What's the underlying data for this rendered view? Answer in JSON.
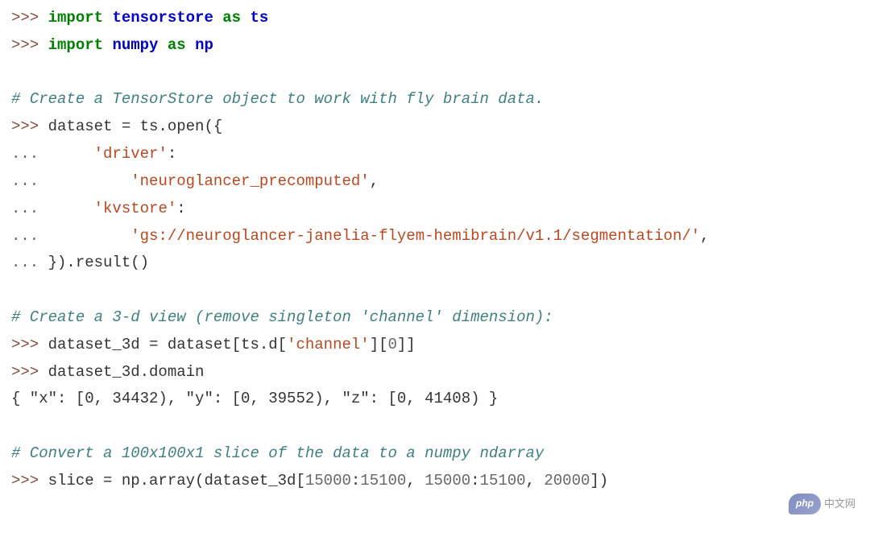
{
  "lines": [
    {
      "segments": [
        {
          "class": "prompt",
          "text": ">>> "
        },
        {
          "class": "keyword",
          "text": "import"
        },
        {
          "class": "normal",
          "text": " "
        },
        {
          "class": "module",
          "text": "tensorstore"
        },
        {
          "class": "normal",
          "text": " "
        },
        {
          "class": "keyword",
          "text": "as"
        },
        {
          "class": "normal",
          "text": " "
        },
        {
          "class": "module",
          "text": "ts"
        }
      ]
    },
    {
      "segments": [
        {
          "class": "prompt",
          "text": ">>> "
        },
        {
          "class": "keyword",
          "text": "import"
        },
        {
          "class": "normal",
          "text": " "
        },
        {
          "class": "module",
          "text": "numpy"
        },
        {
          "class": "normal",
          "text": " "
        },
        {
          "class": "keyword",
          "text": "as"
        },
        {
          "class": "normal",
          "text": " "
        },
        {
          "class": "module",
          "text": "np"
        }
      ]
    },
    {
      "segments": [
        {
          "class": "normal",
          "text": " "
        }
      ]
    },
    {
      "segments": [
        {
          "class": "comment",
          "text": "# Create a TensorStore object to work with fly brain data."
        }
      ]
    },
    {
      "segments": [
        {
          "class": "prompt",
          "text": ">>> "
        },
        {
          "class": "normal",
          "text": "dataset = ts.open({"
        }
      ]
    },
    {
      "segments": [
        {
          "class": "continuation",
          "text": "...      "
        },
        {
          "class": "string",
          "text": "'driver'"
        },
        {
          "class": "normal",
          "text": ":"
        }
      ]
    },
    {
      "segments": [
        {
          "class": "continuation",
          "text": "...          "
        },
        {
          "class": "string",
          "text": "'neuroglancer_precomputed'"
        },
        {
          "class": "normal",
          "text": ","
        }
      ]
    },
    {
      "segments": [
        {
          "class": "continuation",
          "text": "...      "
        },
        {
          "class": "string",
          "text": "'kvstore'"
        },
        {
          "class": "normal",
          "text": ":"
        }
      ]
    },
    {
      "segments": [
        {
          "class": "continuation",
          "text": "...          "
        },
        {
          "class": "string",
          "text": "'gs://neuroglancer-janelia-flyem-hemibrain/v1.1/segmentation/'"
        },
        {
          "class": "normal",
          "text": ","
        }
      ]
    },
    {
      "segments": [
        {
          "class": "continuation",
          "text": "... "
        },
        {
          "class": "normal",
          "text": "}).result()"
        }
      ]
    },
    {
      "segments": [
        {
          "class": "normal",
          "text": " "
        }
      ]
    },
    {
      "segments": [
        {
          "class": "comment",
          "text": "# Create a 3-d view (remove singleton 'channel' dimension):"
        }
      ]
    },
    {
      "segments": [
        {
          "class": "prompt",
          "text": ">>> "
        },
        {
          "class": "normal",
          "text": "dataset_3d = dataset[ts.d["
        },
        {
          "class": "string",
          "text": "'channel'"
        },
        {
          "class": "normal",
          "text": "]["
        },
        {
          "class": "number",
          "text": "0"
        },
        {
          "class": "normal",
          "text": "]]"
        }
      ]
    },
    {
      "segments": [
        {
          "class": "prompt",
          "text": ">>> "
        },
        {
          "class": "normal",
          "text": "dataset_3d.domain"
        }
      ]
    },
    {
      "segments": [
        {
          "class": "normal",
          "text": "{ \"x\": [0, 34432), \"y\": [0, 39552), \"z\": [0, 41408) }"
        }
      ]
    },
    {
      "segments": [
        {
          "class": "normal",
          "text": " "
        }
      ]
    },
    {
      "segments": [
        {
          "class": "comment",
          "text": "# Convert a 100x100x1 slice of the data to a numpy ndarray"
        }
      ]
    },
    {
      "segments": [
        {
          "class": "prompt",
          "text": ">>> "
        },
        {
          "class": "normal",
          "text": "slice = np.array(dataset_3d["
        },
        {
          "class": "number",
          "text": "15000"
        },
        {
          "class": "normal",
          "text": ":"
        },
        {
          "class": "number",
          "text": "15100"
        },
        {
          "class": "normal",
          "text": ", "
        },
        {
          "class": "number",
          "text": "15000"
        },
        {
          "class": "normal",
          "text": ":"
        },
        {
          "class": "number",
          "text": "15100"
        },
        {
          "class": "normal",
          "text": ", "
        },
        {
          "class": "number",
          "text": "20000"
        },
        {
          "class": "normal",
          "text": "])"
        }
      ]
    }
  ],
  "watermark": "中文网"
}
